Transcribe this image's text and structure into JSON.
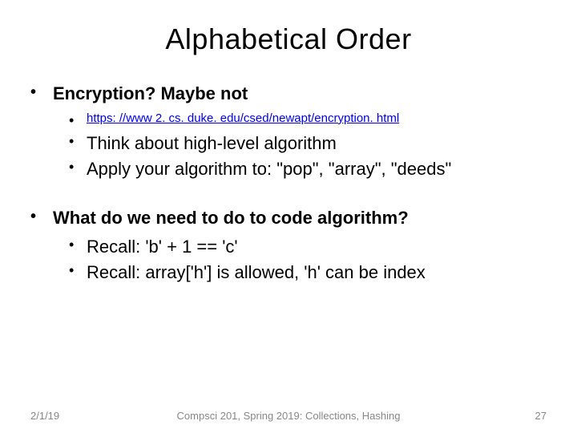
{
  "title": "Alphabetical Order",
  "sections": [
    {
      "heading": "Encryption? Maybe not",
      "items": [
        {
          "type": "link",
          "text": "https: //www 2. cs. duke. edu/csed/newapt/encryption. html"
        },
        {
          "type": "normal",
          "text": "Think about high-level algorithm"
        },
        {
          "type": "normal",
          "text": "Apply your algorithm to: \"pop\", \"array\", \"deeds\""
        }
      ]
    },
    {
      "heading": "What do we need to do to code algorithm?",
      "items": [
        {
          "type": "normal",
          "text": "Recall: 'b' + 1 == 'c'"
        },
        {
          "type": "normal",
          "text": "Recall: array['h'] is allowed, 'h' can be index"
        }
      ]
    }
  ],
  "footer": {
    "date": "2/1/19",
    "center": "Compsci 201, Spring 2019: Collections, Hashing",
    "pageno": "27"
  }
}
